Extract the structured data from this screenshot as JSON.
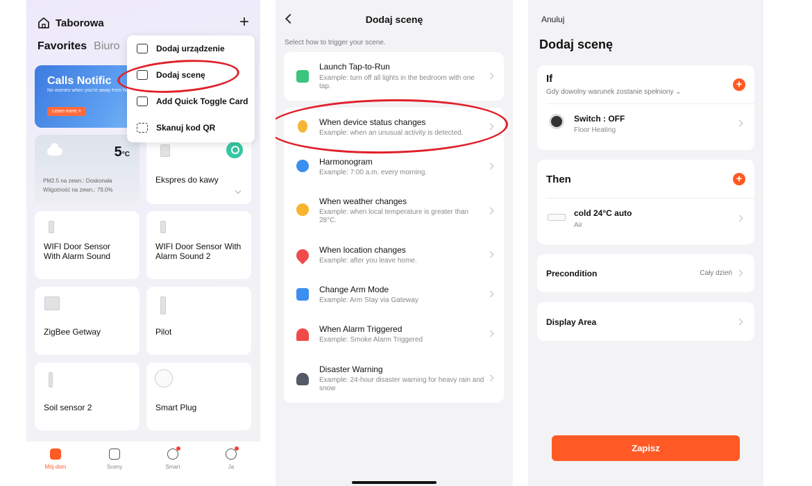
{
  "home": {
    "title": "Taborowa",
    "tabs": [
      "Favorites",
      "Biuro"
    ],
    "banner": {
      "title": "Calls Notific",
      "subtitle": "No worries when you're away from home",
      "button": "Learn more >"
    },
    "weather": {
      "temp": "5",
      "unit": "°C",
      "pm25": "PM2.5 na zewn.: Doskonała",
      "humidity": "Wilgotność na zewn.: 79.0%"
    },
    "devices": [
      "Ekspres do kawy",
      "WIFI Door Sensor With Alarm Sound",
      "WIFI Door Sensor With Alarm Sound 2",
      "ZigBee Getway",
      "Pilot",
      "Soil sensor 2",
      "Smart Plug"
    ],
    "menu": [
      "Dodaj urządzenie",
      "Dodaj scenę",
      "Add Quick Toggle Card",
      "Skanuj kod QR"
    ],
    "tabbar": [
      "Mój dom",
      "Sceny",
      "Smart",
      "Ja"
    ]
  },
  "scene_type": {
    "title": "Dodaj scenę",
    "subtitle": "Select how to trigger your scene.",
    "items": [
      {
        "title": "Launch Tap-to-Run",
        "desc": "Example: turn off all lights in the bedroom with one tap.",
        "color": "#3cc37c"
      },
      {
        "title": "When device status changes",
        "desc": "Example: when an unusual activity is detected.",
        "color": "#f5b638"
      },
      {
        "title": "Harmonogram",
        "desc": "Example: 7:00 a.m. every morning.",
        "color": "#3b8ff0"
      },
      {
        "title": "When weather changes",
        "desc": "Example: when local temperature is greater than 28°C.",
        "color": "#f7b42c"
      },
      {
        "title": "When location changes",
        "desc": "Example: after you leave home.",
        "color": "#f04b4b"
      },
      {
        "title": "Change Arm Mode",
        "desc": "Example: Arm Stay via Gateway",
        "color": "#3b8ff0"
      },
      {
        "title": "When Alarm Triggered",
        "desc": "Example: Smoke Alarm Triggered",
        "color": "#f04b4b"
      },
      {
        "title": "Disaster Warning",
        "desc": "Example: 24-hour disaster warning for heavy rain and snow",
        "color": "#555a66"
      }
    ]
  },
  "scene_edit": {
    "cancel": "Anuluj",
    "title": "Dodaj scenę",
    "if_label": "If",
    "if_sub": "Gdy dowolny warunek zostanie spełniony ⌄",
    "condition": {
      "title": "Switch : OFF",
      "sub": "Floor Heating"
    },
    "then_label": "Then",
    "action": {
      "title": "cold 24°C auto",
      "sub": "Air"
    },
    "precondition": {
      "label": "Precondition",
      "value": "Cały dzień"
    },
    "display_area": "Display Area",
    "save": "Zapisz"
  },
  "colors": {
    "accent": "#ff5a25",
    "highlight": "#e0202a",
    "power": "#35c9a3"
  }
}
